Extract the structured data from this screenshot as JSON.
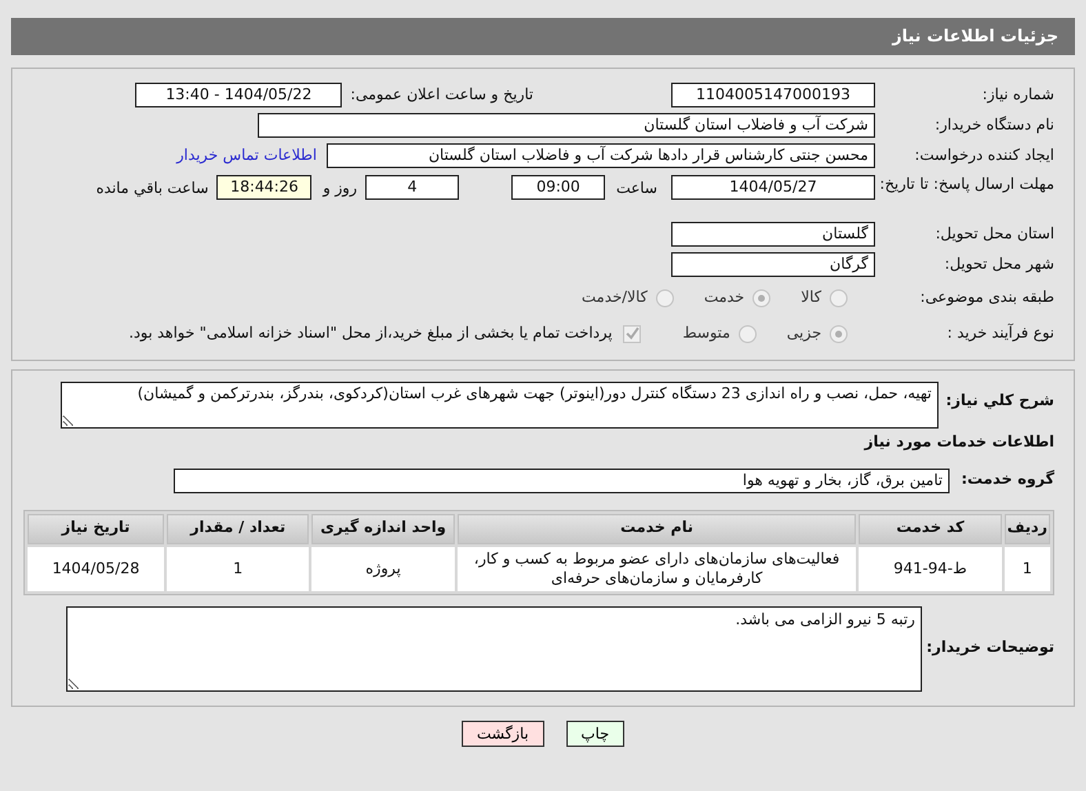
{
  "header": {
    "title": "جزئیات اطلاعات نیاز"
  },
  "need_number": {
    "label": "شماره نیاز:",
    "value": "1104005147000193"
  },
  "announce": {
    "label": "تاریخ و ساعت اعلان عمومی:",
    "value": "1404/05/22 - 13:40"
  },
  "buyer_org": {
    "label": "نام دستگاه خریدار:",
    "value": "شرکت آب و فاضلاب استان گلستان"
  },
  "creator": {
    "label": "ایجاد کننده درخواست:",
    "value": "محسن جنتی کارشناس قرار دادها شرکت آب و فاضلاب استان گلستان",
    "link": "اطلاعات تماس خریدار"
  },
  "deadline": {
    "label": "مهلت ارسال پاسخ: تا تاریخ:",
    "date": "1404/05/27",
    "time_label": "ساعت",
    "time": "09:00",
    "days": "4",
    "days_label": "روز و",
    "remaining": "18:44:26",
    "remaining_label": "ساعت باقي مانده"
  },
  "province": {
    "label": "استان محل تحویل:",
    "value": "گلستان"
  },
  "city": {
    "label": "شهر محل تحویل:",
    "value": "گرگان"
  },
  "category": {
    "label": "طبقه بندی موضوعی:",
    "disabled": true,
    "options": [
      {
        "label": "کالا",
        "selected": false
      },
      {
        "label": "خدمت",
        "selected": true
      },
      {
        "label": "کالا/خدمت",
        "selected": false
      }
    ]
  },
  "process": {
    "label": "نوع فرآیند خرید :",
    "disabled": true,
    "options": [
      {
        "label": "جزیی",
        "selected": true
      },
      {
        "label": "متوسط",
        "selected": false
      }
    ],
    "treasury": {
      "checked": true,
      "disabled": true,
      "label": "پرداخت تمام یا بخشی از مبلغ خرید،از محل \"اسناد خزانه اسلامی\" خواهد بود."
    }
  },
  "summary": {
    "label": "شرح کلي نیاز:",
    "value": "تهیه، حمل، نصب و راه اندازی 23 دستگاه کنترل دور(اینوتر) جهت شهرهای غرب استان(کردکوی، بندرگز، بندرترکمن و گمیشان)"
  },
  "services_heading": "اطلاعات خدمات مورد نیاز",
  "service_group": {
    "label": "گروه خدمت:",
    "value": "تامین برق، گاز، بخار و تهویه هوا"
  },
  "table": {
    "columns": [
      "ردیف",
      "کد خدمت",
      "نام خدمت",
      "واحد اندازه گیری",
      "تعداد / مقدار",
      "تاریخ نیاز"
    ],
    "rows": [
      [
        "1",
        "ط-94-941",
        "فعالیت‌های سازمان‌های دارای عضو مربوط به کسب و کار، کارفرمایان و سازمان‌های حرفه‌ای",
        "پروژه",
        "1",
        "1404/05/28"
      ]
    ]
  },
  "buyer_notes": {
    "label": "توضیحات خریدار:",
    "value": "رتبه 5 نیرو الزامی می باشد."
  },
  "buttons": [
    {
      "label": "چاپ",
      "kind": "print"
    },
    {
      "label": "بازگشت",
      "kind": "back"
    }
  ]
}
